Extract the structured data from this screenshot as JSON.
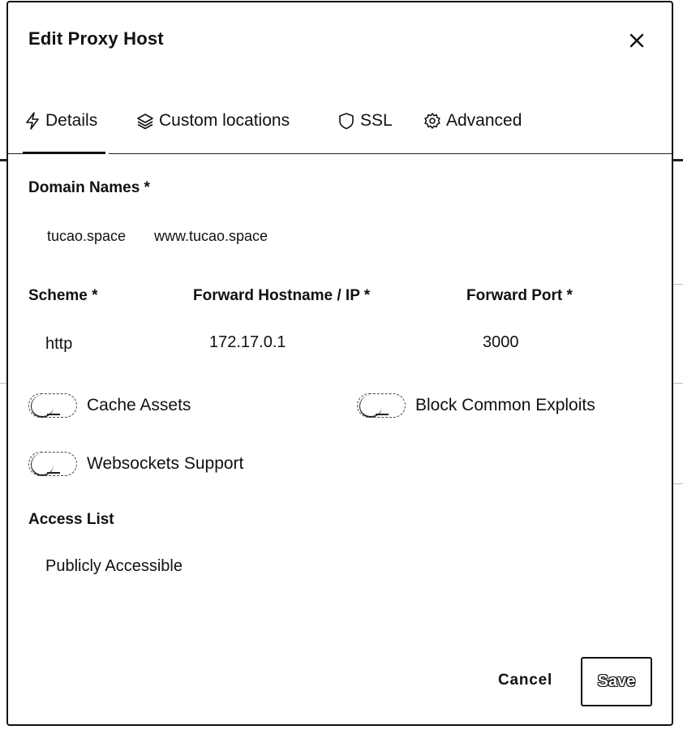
{
  "modal": {
    "title": "Edit Proxy Host",
    "close_icon": "close-icon"
  },
  "tabs": [
    {
      "label": "Details",
      "icon": "bolt-icon",
      "active": true
    },
    {
      "label": "Custom locations",
      "icon": "layers-icon",
      "active": false
    },
    {
      "label": "SSL",
      "icon": "shield-icon",
      "active": false
    },
    {
      "label": "Advanced",
      "icon": "gear-icon",
      "active": false
    }
  ],
  "domain_names": {
    "label": "Domain Names *",
    "values": [
      "tucao.space",
      "www.tucao.space"
    ]
  },
  "scheme": {
    "label": "Scheme *",
    "value": "http"
  },
  "forward_host": {
    "label": "Forward Hostname / IP *",
    "value": "172.17.0.1"
  },
  "forward_port": {
    "label": "Forward Port *",
    "value": "3000"
  },
  "toggles": {
    "cache_assets": {
      "label": "Cache Assets",
      "on": false
    },
    "block_exploits": {
      "label": "Block Common Exploits",
      "on": false
    },
    "websockets": {
      "label": "Websockets Support",
      "on": false
    }
  },
  "access_list": {
    "label": "Access List",
    "value": "Publicly Accessible"
  },
  "footer": {
    "cancel_label": "Cancel",
    "save_label": "Save"
  }
}
